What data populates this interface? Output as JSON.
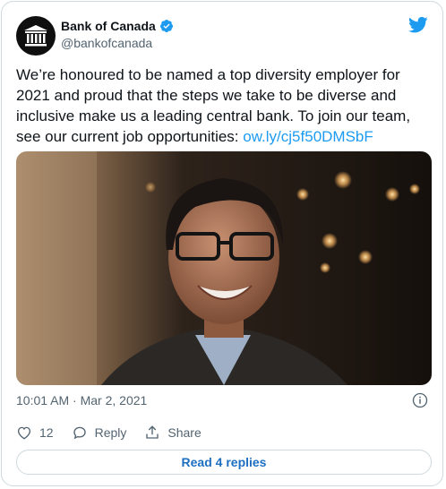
{
  "account": {
    "name": "Bank of Canada",
    "handle": "@bankofcanada",
    "verified": true
  },
  "tweet": {
    "text": "We’re honoured to be named a top diversity employer for 2021 and proud that the steps we take to be diverse and inclusive make us a leading central bank. To join our team, see our current job opportunities: ",
    "link": "ow.ly/cj5f50DMSbF",
    "timestamp": "10:01 AM · Mar 2, 2021"
  },
  "actions": {
    "like_count": "12",
    "reply_label": "Reply",
    "share_label": "Share"
  },
  "read_replies_label": "Read 4 replies",
  "colors": {
    "accent": "#1d9bf0",
    "text": "#0f1419",
    "muted": "#536471",
    "border": "#cfd9de"
  },
  "icons": [
    "bank-logo-icon",
    "verified-badge-icon",
    "twitter-bird-icon",
    "info-icon",
    "heart-icon",
    "reply-icon",
    "share-icon"
  ]
}
